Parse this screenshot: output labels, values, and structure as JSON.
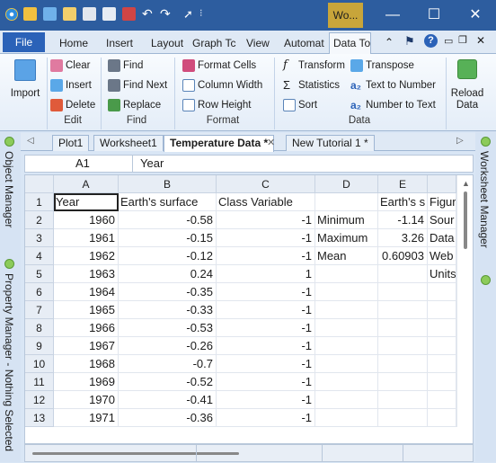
{
  "window": {
    "tab_title": "Wo...",
    "controls": {
      "minimize": "—",
      "maximize": "☐",
      "close": "✕"
    }
  },
  "ribbon_tabs": [
    "File",
    "Home",
    "Insert",
    "Layout",
    "Graph Tc",
    "View",
    "Automat",
    "Data Toc"
  ],
  "ribbon": {
    "import": "Import",
    "edit": {
      "clear": "Clear",
      "insert": "Insert",
      "delete": "Delete",
      "group": "Edit"
    },
    "find": {
      "find": "Find",
      "find_next": "Find Next",
      "replace": "Replace",
      "group": "Find"
    },
    "format": {
      "format_cells": "Format Cells",
      "column_width": "Column Width",
      "row_height": "Row Height",
      "group": "Format"
    },
    "data": {
      "transform": "Transform",
      "transpose": "Transpose",
      "statistics": "Statistics",
      "text_to_number": "Text to Number",
      "sort": "Sort",
      "number_to_text": "Number to Text",
      "group": "Data"
    },
    "reload": "Reload\nData"
  },
  "panels": {
    "left_top": "Object Manager",
    "left_bottom": "Property Manager - Nothing Selected",
    "right": "Worksheet Manager"
  },
  "workbook_tabs": [
    "Plot1",
    "Worksheet1",
    "Temperature Data *",
    "New Tutorial 1 *"
  ],
  "formula": {
    "ref": "A1",
    "value": "Year"
  },
  "columns": [
    "A",
    "B",
    "C",
    "D",
    "E",
    ""
  ],
  "rows": [
    {
      "n": "1",
      "a": "Year",
      "b": "Earth's surface",
      "c": "Class Variable",
      "d": "",
      "e": "Earth's s",
      "f": "Figur"
    },
    {
      "n": "2",
      "a": "1960",
      "b": "-0.58",
      "c": "-1",
      "d": "Minimum",
      "e": "-1.14",
      "f": "Sour"
    },
    {
      "n": "3",
      "a": "1961",
      "b": "-0.15",
      "c": "-1",
      "d": "Maximum",
      "e": "3.26",
      "f": "Data"
    },
    {
      "n": "4",
      "a": "1962",
      "b": "-0.12",
      "c": "-1",
      "d": "Mean",
      "e": "0.60903",
      "f": "Web"
    },
    {
      "n": "5",
      "a": "1963",
      "b": "0.24",
      "c": "1",
      "d": "",
      "e": "",
      "f": "Units"
    },
    {
      "n": "6",
      "a": "1964",
      "b": "-0.35",
      "c": "-1",
      "d": "",
      "e": "",
      "f": ""
    },
    {
      "n": "7",
      "a": "1965",
      "b": "-0.33",
      "c": "-1",
      "d": "",
      "e": "",
      "f": ""
    },
    {
      "n": "8",
      "a": "1966",
      "b": "-0.53",
      "c": "-1",
      "d": "",
      "e": "",
      "f": ""
    },
    {
      "n": "9",
      "a": "1967",
      "b": "-0.26",
      "c": "-1",
      "d": "",
      "e": "",
      "f": ""
    },
    {
      "n": "10",
      "a": "1968",
      "b": "-0.7",
      "c": "-1",
      "d": "",
      "e": "",
      "f": ""
    },
    {
      "n": "11",
      "a": "1969",
      "b": "-0.52",
      "c": "-1",
      "d": "",
      "e": "",
      "f": ""
    },
    {
      "n": "12",
      "a": "1970",
      "b": "-0.41",
      "c": "-1",
      "d": "",
      "e": "",
      "f": ""
    },
    {
      "n": "13",
      "a": "1971",
      "b": "-0.36",
      "c": "-1",
      "d": "",
      "e": "",
      "f": ""
    }
  ]
}
